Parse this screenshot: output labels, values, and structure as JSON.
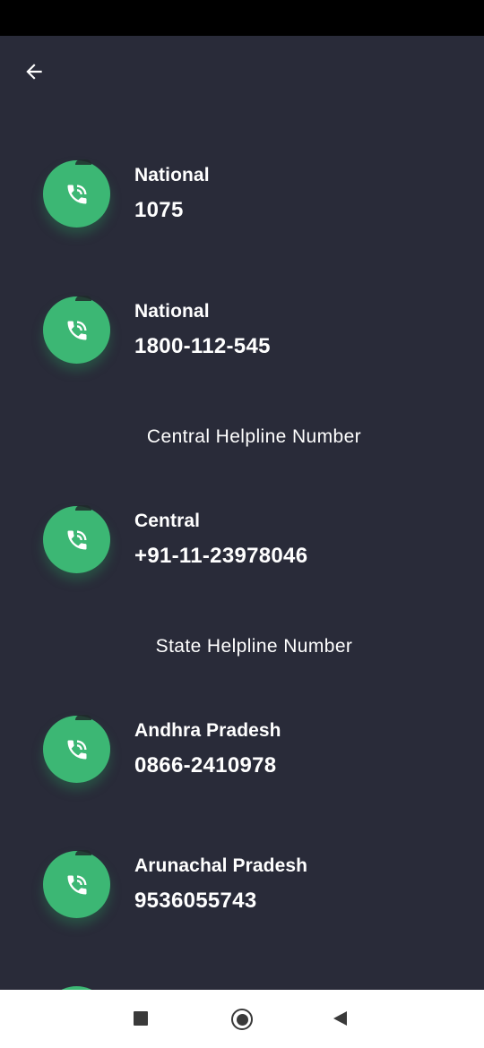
{
  "header": {
    "back_icon": "arrow-left-icon"
  },
  "contacts_top": [
    {
      "label": "National",
      "number": "1075",
      "icon": "phone-in-talk-icon"
    },
    {
      "label": "National",
      "number": "1800-112-545",
      "icon": "phone-in-talk-icon"
    }
  ],
  "section_central": "Central Helpline Number",
  "contacts_central": [
    {
      "label": "Central",
      "number": "+91-11-23978046",
      "icon": "phone-in-talk-icon"
    }
  ],
  "section_state": "State Helpline Number",
  "contacts_state": [
    {
      "label": "Andhra Pradesh",
      "number": "0866-2410978",
      "icon": "phone-in-talk-icon"
    },
    {
      "label": "Arunachal Pradesh",
      "number": "9536055743",
      "icon": "phone-in-talk-icon"
    }
  ],
  "colors": {
    "background": "#292b39",
    "accent": "#3cb774",
    "status_bar": "#000000",
    "nav_bar": "#ffffff"
  },
  "navigation": {
    "recent_icon": "square-icon",
    "home_icon": "circle-icon",
    "back_icon": "triangle-back-icon"
  }
}
